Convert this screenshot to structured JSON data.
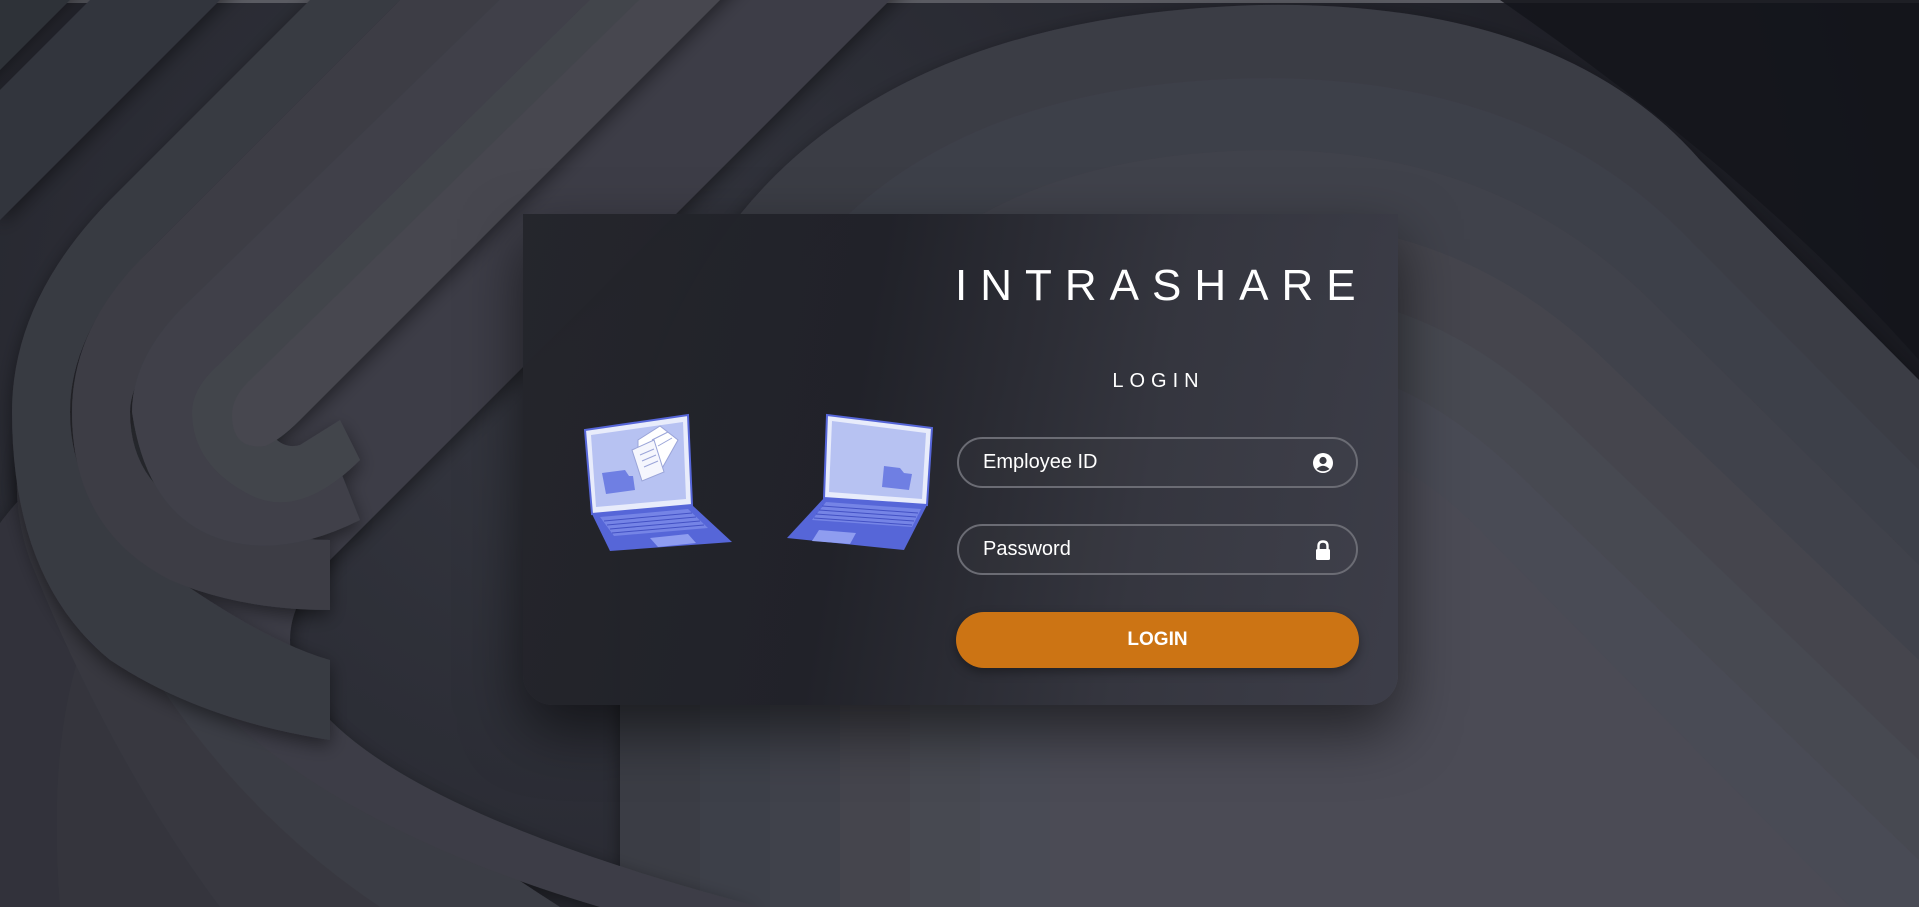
{
  "app": {
    "brand_title": "INTRASHARE"
  },
  "login_form": {
    "heading": "LOGIN",
    "employee_id": {
      "placeholder": "Employee ID",
      "value": "",
      "icon": "user-circle-icon"
    },
    "password": {
      "placeholder": "Password",
      "value": "",
      "icon": "lock-icon"
    },
    "submit_label": "LOGIN"
  },
  "illustration": {
    "items": [
      "laptop-sending-files",
      "laptop-receiving-folder"
    ]
  },
  "colors": {
    "accent": "#cc7414",
    "card": "#2b2c34",
    "background": "#25262d",
    "laptop_body": "#5666d8",
    "laptop_screen": "#b7c2f2",
    "text": "#ffffff"
  }
}
